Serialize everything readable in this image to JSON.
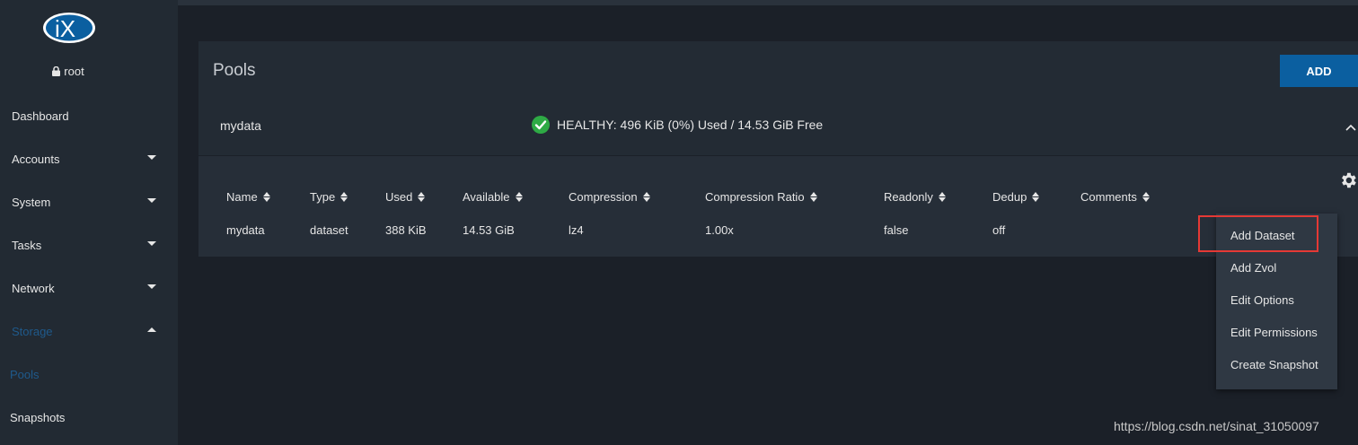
{
  "sidebar": {
    "logo_text": "iX",
    "user": "root",
    "items": [
      {
        "label": "Dashboard"
      },
      {
        "label": "Accounts"
      },
      {
        "label": "System"
      },
      {
        "label": "Tasks"
      },
      {
        "label": "Network"
      },
      {
        "label": "Storage"
      },
      {
        "label": "Pools"
      },
      {
        "label": "Snapshots"
      }
    ]
  },
  "main": {
    "title": "Pools",
    "add_label": "ADD",
    "pool": {
      "name": "mydata",
      "status": "HEALTHY: 496 KiB (0%) Used / 14.53 GiB Free"
    },
    "table": {
      "headers": [
        "Name",
        "Type",
        "Used",
        "Available",
        "Compression",
        "Compression Ratio",
        "Readonly",
        "Dedup",
        "Comments"
      ],
      "row": [
        "mydata",
        "dataset",
        "388 KiB",
        "14.53 GiB",
        "lz4",
        "1.00x",
        "false",
        "off",
        ""
      ]
    }
  },
  "menu": {
    "items": [
      "Add Dataset",
      "Add Zvol",
      "Edit Options",
      "Edit Permissions",
      "Create Snapshot"
    ]
  },
  "watermark": "https://blog.csdn.net/sinat_31050097",
  "colors": {
    "accent": "#0b5fa0",
    "active_nav": "#1f5a8c",
    "healthy": "#2eaa45",
    "highlight": "#e53935"
  }
}
